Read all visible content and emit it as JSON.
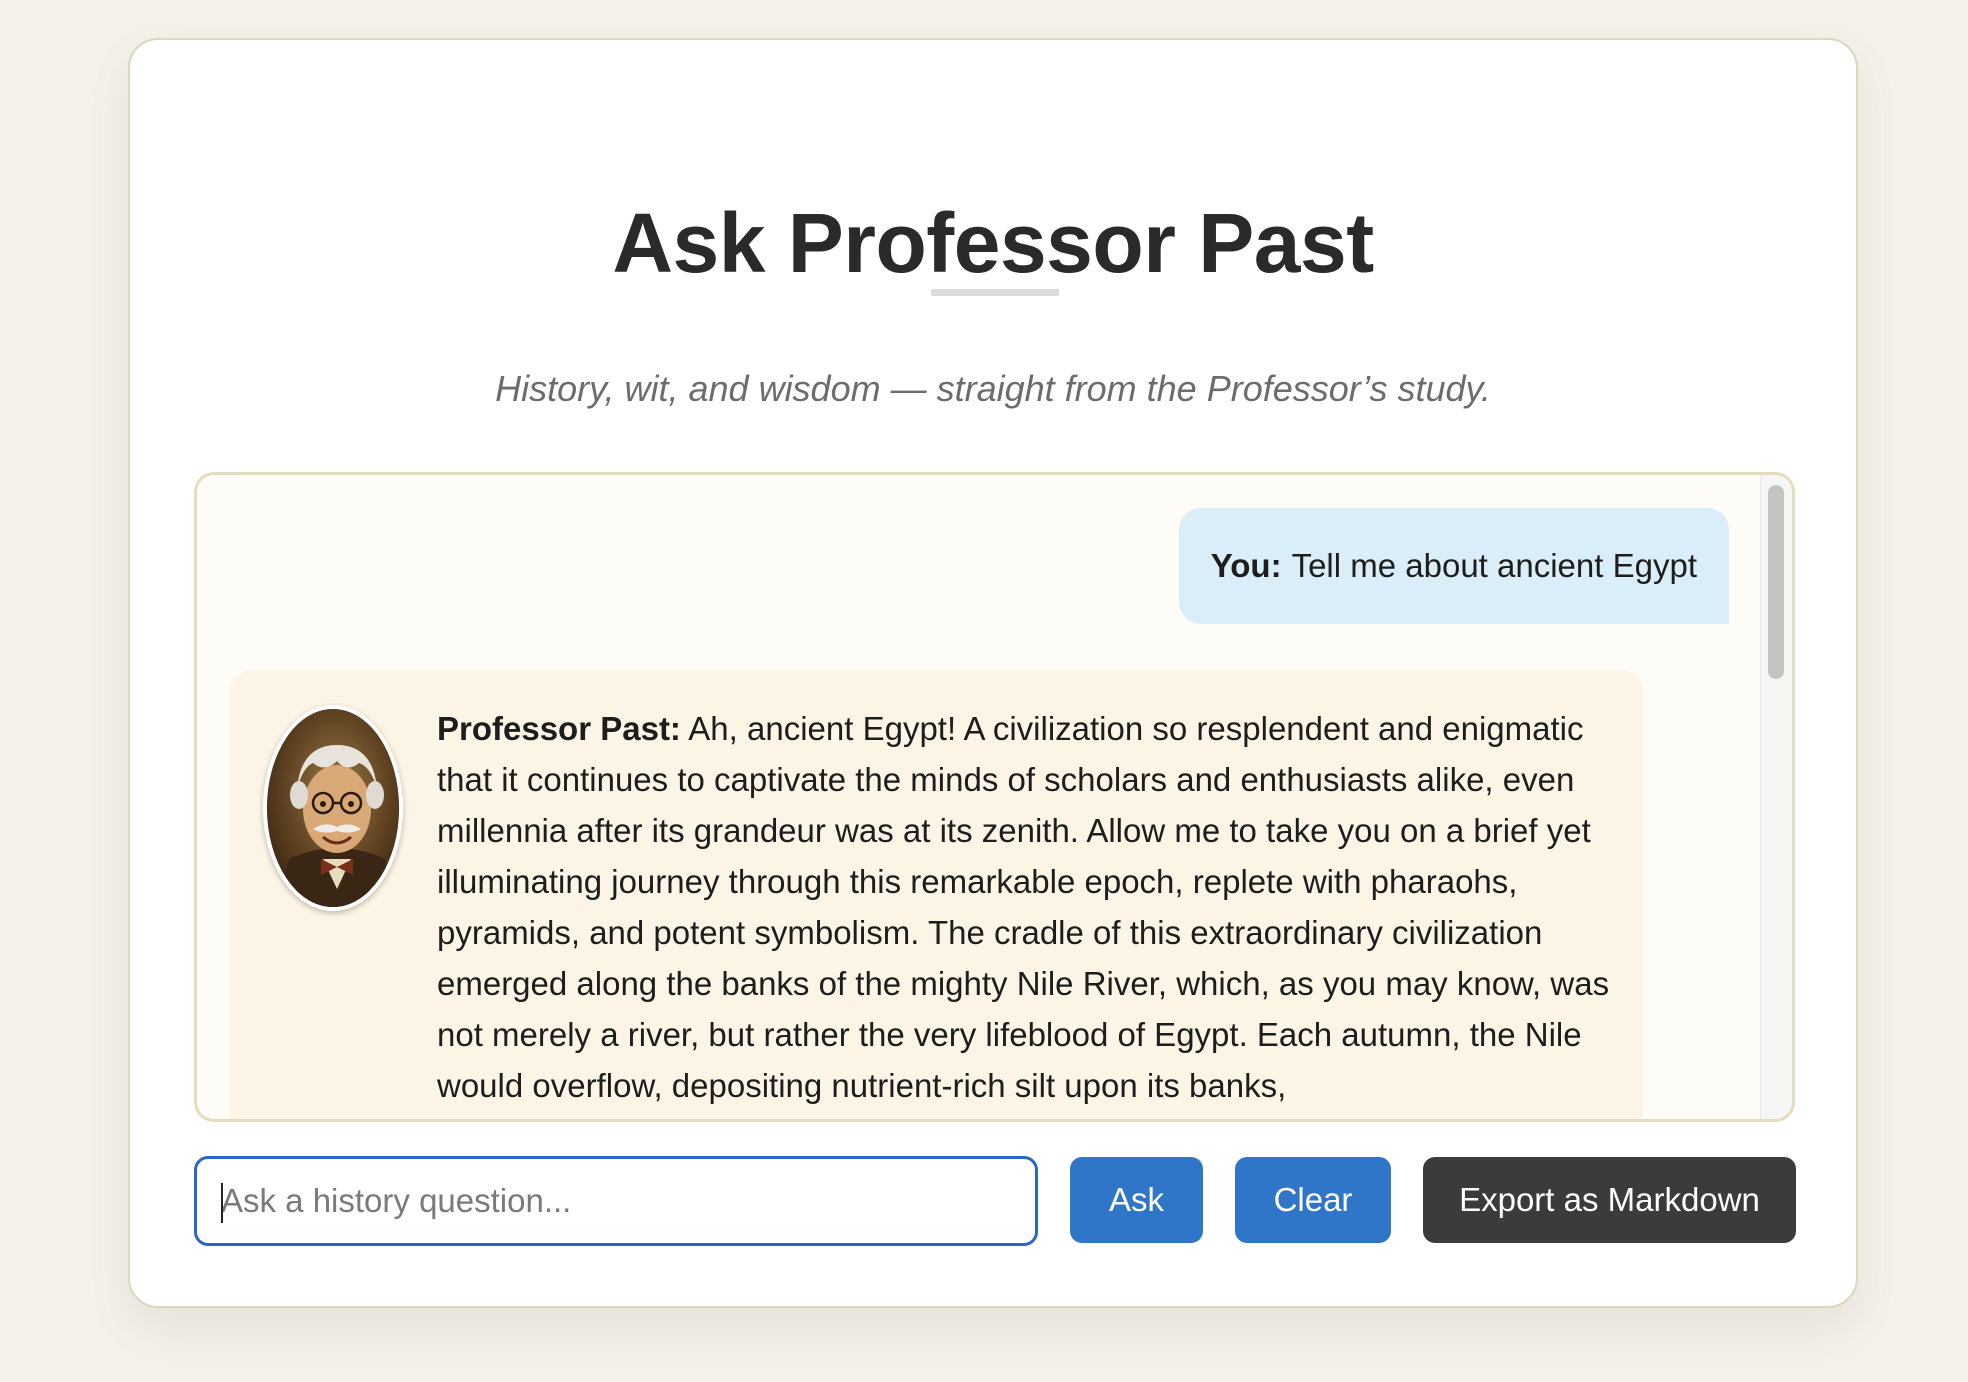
{
  "header": {
    "title": "Ask Professor Past",
    "subtitle": "History, wit, and wisdom — straight from the Professor’s study."
  },
  "chat": {
    "messages": [
      {
        "role": "user",
        "speaker": "You:",
        "text": "Tell me about ancient Egypt"
      },
      {
        "role": "assistant",
        "speaker": "Professor Past:",
        "avatar": "professor-portrait",
        "text": "Ah, ancient Egypt! A civilization so resplendent and enigmatic that it continues to captivate the minds of scholars and enthusiasts alike, even millennia after its grandeur was at its zenith. Allow me to take you on a brief yet illuminating journey through this remarkable epoch, replete with pharaohs, pyramids, and potent symbolism. The cradle of this extraordinary civilization emerged along the banks of the mighty Nile River, which, as you may know, was not merely a river, but rather the very lifeblood of Egypt. Each autumn, the Nile would overflow, depositing nutrient-rich silt upon its banks,"
      }
    ]
  },
  "composer": {
    "placeholder": "Ask a history question...",
    "value": ""
  },
  "actions": {
    "ask_label": "Ask",
    "clear_label": "Clear",
    "export_label": "Export as Markdown"
  },
  "colors": {
    "primary_button": "#2f76c9",
    "export_button": "#3b3b3b",
    "user_bubble": "#d9eef9",
    "bot_bubble": "#fcf4e4",
    "focus_border": "#2e66c7"
  }
}
